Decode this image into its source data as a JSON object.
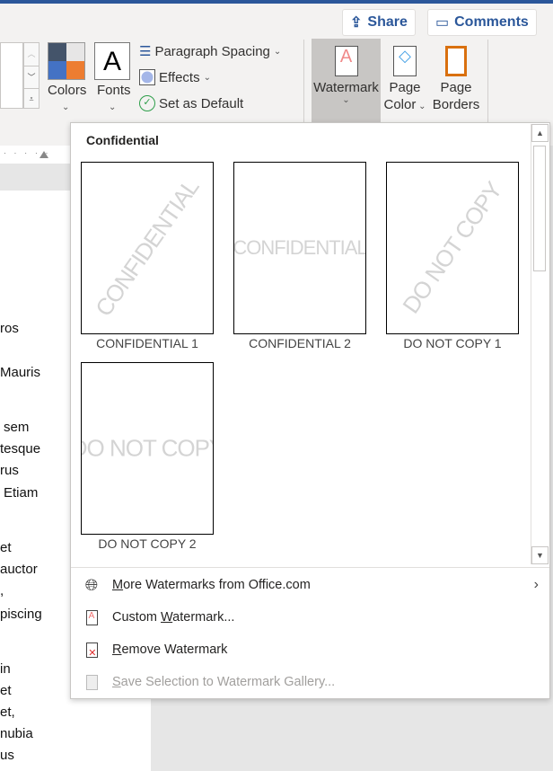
{
  "header": {
    "share_label": "Share",
    "comments_label": "Comments"
  },
  "ribbon": {
    "colors_label": "Colors",
    "fonts_label": "Fonts",
    "fonts_glyph": "A",
    "paragraph_spacing_label": "Paragraph Spacing",
    "effects_label": "Effects",
    "set_default_label": "Set as Default",
    "watermark_label": "Watermark",
    "page_color_label": [
      "Page",
      "Color"
    ],
    "page_borders_label": [
      "Page",
      "Borders"
    ]
  },
  "document": {
    "fragments": [
      "ros",
      "Mauris",
      "sem",
      "tesque",
      "rus",
      "Etiam",
      "et",
      "auctor",
      ",",
      "piscing",
      "in",
      "et",
      "et,",
      "nubia",
      "us"
    ]
  },
  "watermark_menu": {
    "section_title": "Confidential",
    "gallery": [
      {
        "label": "CONFIDENTIAL 1",
        "text": "CONFIDENTIAL",
        "orientation": "diagonal"
      },
      {
        "label": "CONFIDENTIAL 2",
        "text": "CONFIDENTIAL",
        "orientation": "horizontal"
      },
      {
        "label": "DO NOT COPY 1",
        "text": "DO NOT COPY",
        "orientation": "diagonal"
      },
      {
        "label": "DO NOT COPY 2",
        "text": "DO NOT COPY",
        "orientation": "horizontal"
      }
    ],
    "items": [
      {
        "pre": "",
        "key": "M",
        "post": "ore Watermarks from Office.com",
        "icon": "globe-icon",
        "enabled": true,
        "submenu": true
      },
      {
        "pre": "Custom ",
        "key": "W",
        "post": "atermark...",
        "icon": "custom-watermark-icon",
        "enabled": true
      },
      {
        "pre": "",
        "key": "R",
        "post": "emove Watermark",
        "icon": "remove-watermark-icon",
        "enabled": true
      },
      {
        "pre": "",
        "key": "S",
        "post": "ave Selection to Watermark Gallery...",
        "icon": "save-gallery-icon",
        "enabled": false
      }
    ]
  },
  "colors": {
    "accent": "#2b579a",
    "swatch": [
      "#44546a",
      "#e7e6e6",
      "#4472c4",
      "#ed7d31"
    ]
  }
}
